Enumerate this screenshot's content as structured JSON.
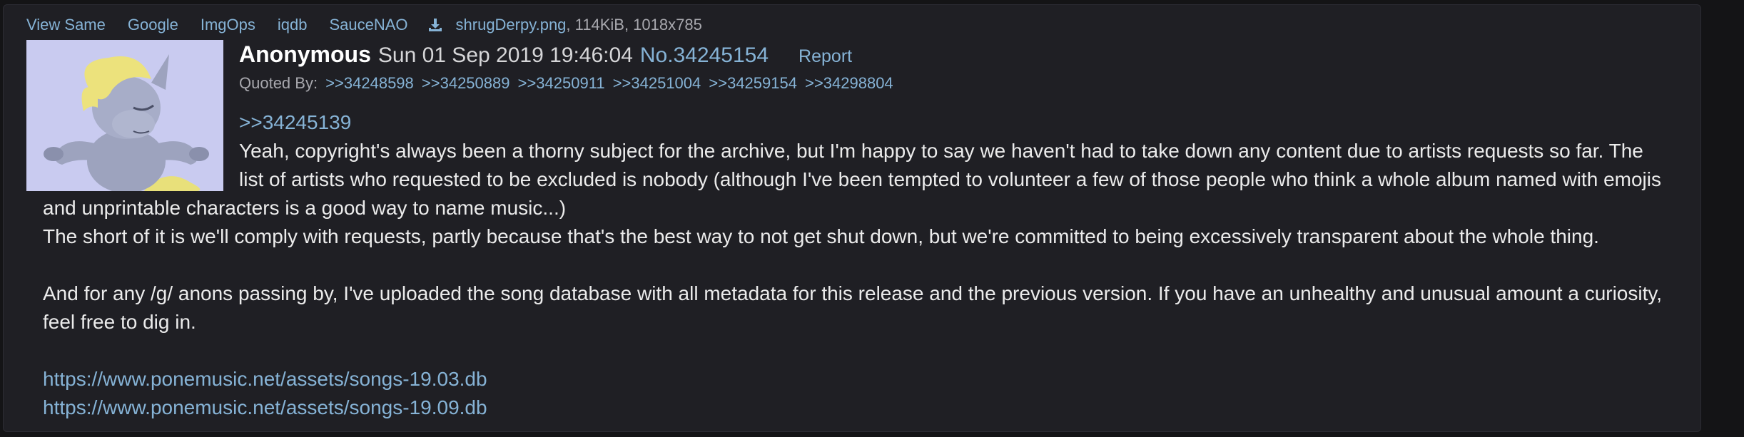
{
  "file_bar": {
    "tools": [
      "View Same",
      "Google",
      "ImgOps",
      "iqdb",
      "SauceNAO"
    ],
    "filename": "shrugDerpy.png",
    "fileinfo": ", 114KiB, 1018x785"
  },
  "post": {
    "name": "Anonymous",
    "date": "Sun 01 Sep 2019 19:46:04",
    "number": "No.34245154",
    "report": "Report",
    "quoted_by_label": "Quoted By:",
    "quoted_by": [
      ">>34248598",
      ">>34250889",
      ">>34250911",
      ">>34251004",
      ">>34259154",
      ">>34298804"
    ],
    "quote_link": ">>34245139",
    "lines": [
      "Yeah, copyright's always been a thorny subject for the archive, but I'm happy to say we haven't had to take down any content due to artists requests so far. The",
      "list of artists who requested to be excluded is nobody (although I've been tempted to volunteer a few of those people who think a whole album named with emojis",
      "and unprintable characters is a good way to name music...)",
      "The short of it is we'll comply with requests, partly because that's the best way to not get shut down, but we're committed to being excessively transparent about the whole thing.",
      "And for any /g/ anons passing by, I've uploaded the song database with all metadata for this release and the previous version. If you have an unhealthy and unusual amount a curiosity,",
      "feel free to dig in."
    ],
    "links": [
      "https://www.ponemusic.net/assets/songs-19.03.db",
      "https://www.ponemusic.net/assets/songs-19.09.db"
    ]
  },
  "colors": {
    "page_bg": "#141416",
    "post_bg": "#1f1f24",
    "link": "#86b3d6",
    "text": "#ebebeb",
    "thumb_bg": "#c9cbf0"
  },
  "icons": {
    "download": "download-icon"
  }
}
